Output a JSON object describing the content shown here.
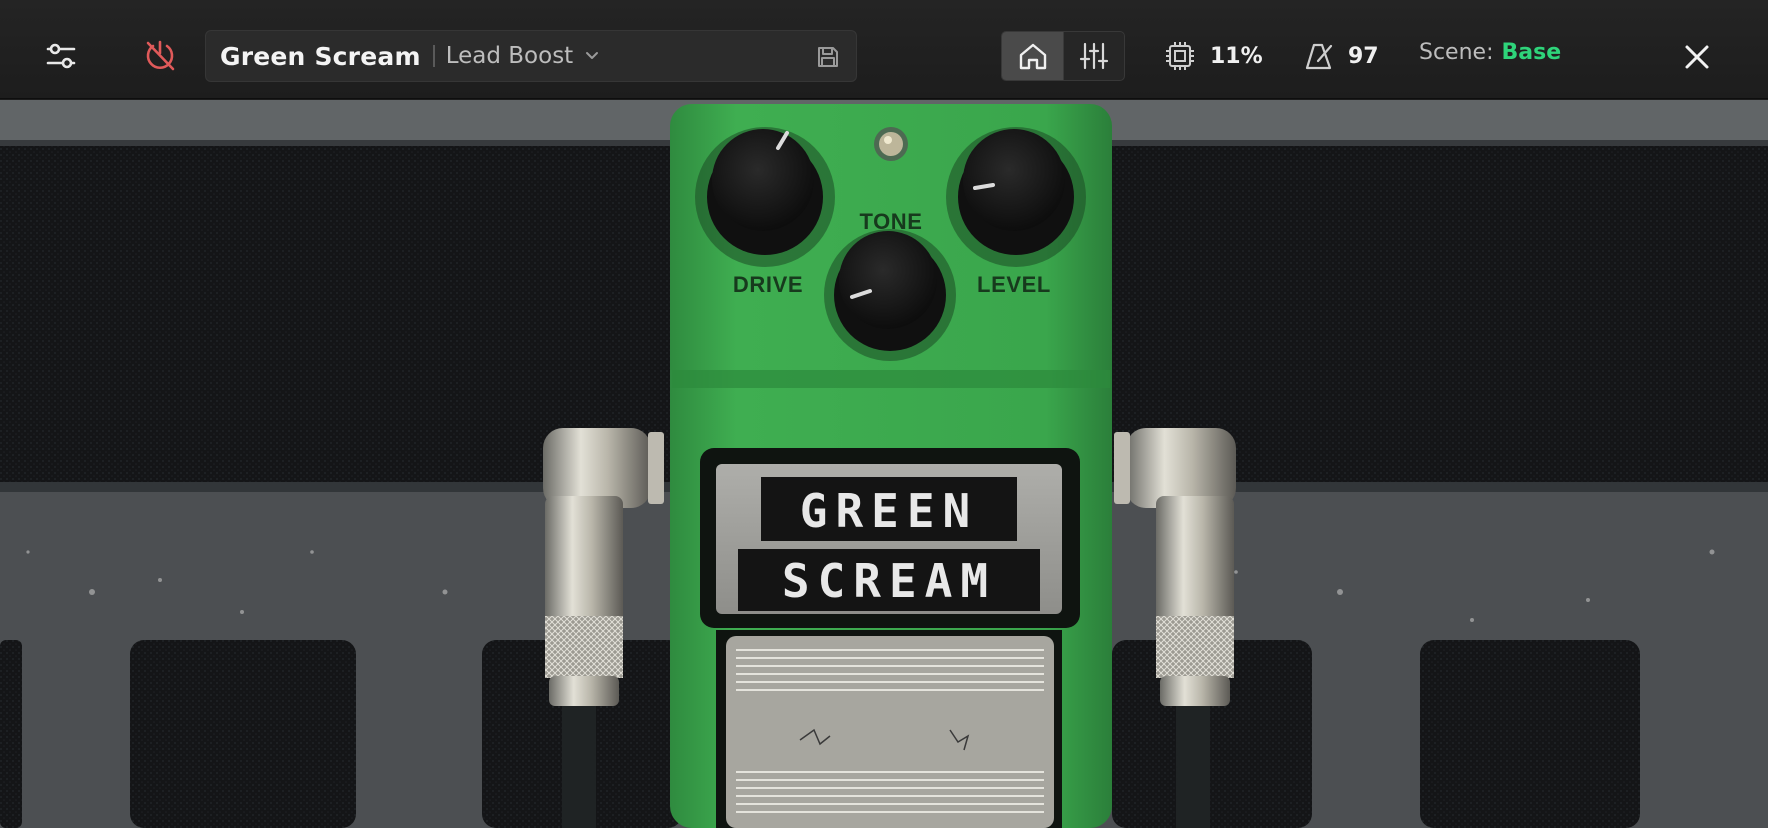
{
  "toolbar": {
    "preset_name": "Green Scream",
    "preset_variant": "Lead Boost",
    "cpu_value": "11%",
    "tempo_value": "97",
    "scene_label": "Scene:",
    "scene_value": "Base",
    "active_view": "home"
  },
  "pedal": {
    "label_line1": "GREEN",
    "label_line2": "SCREAM",
    "knobs": {
      "drive": "DRIVE",
      "tone": "TONE",
      "level": "LEVEL"
    }
  },
  "colors": {
    "accent_green": "#2ed47a",
    "bypass_icon": "#e05a5a",
    "pedal_green": "#38a64c"
  },
  "icons": [
    "sliders-icon",
    "power-off-icon",
    "chevron-down-icon",
    "save-icon",
    "home-icon",
    "mixer-icon",
    "cpu-icon",
    "metronome-icon",
    "close-icon"
  ]
}
